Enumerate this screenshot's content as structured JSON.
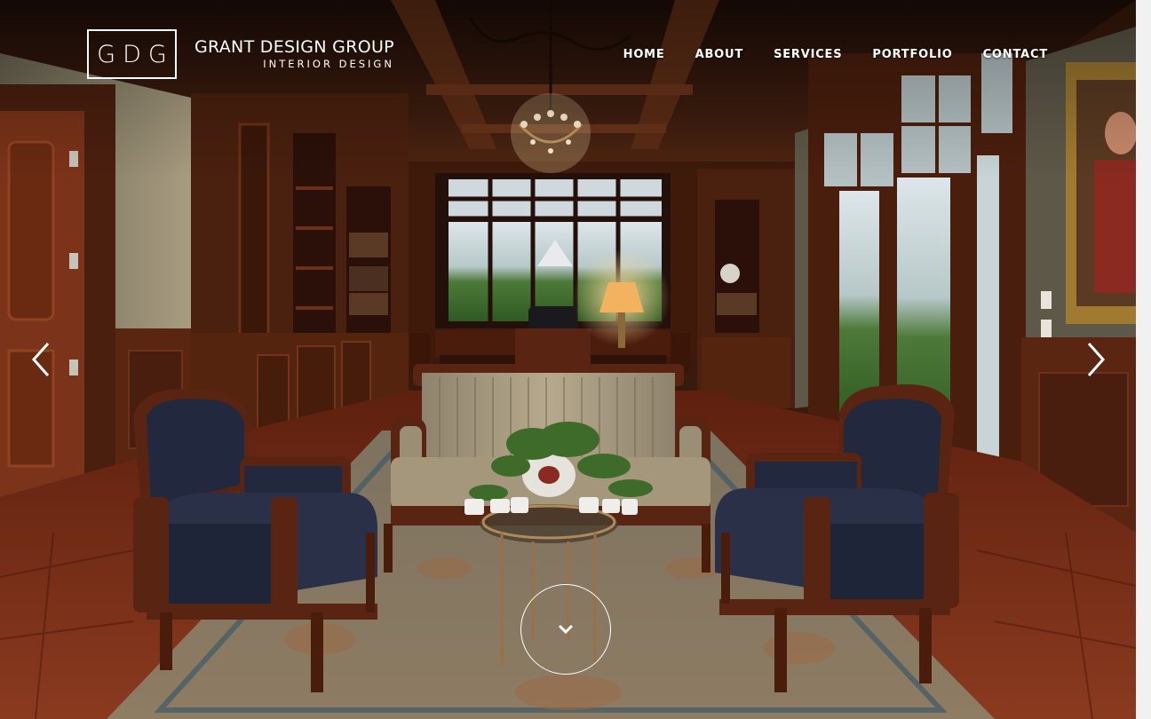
{
  "brand": {
    "monogram": "GDG",
    "name": "GRANT DESIGN GROUP",
    "tagline": "INTERIOR DESIGN"
  },
  "nav": {
    "items": [
      {
        "label": "HOME"
      },
      {
        "label": "ABOUT"
      },
      {
        "label": "SERVICES"
      },
      {
        "label": "PORTFOLIO"
      },
      {
        "label": "CONTACT"
      }
    ]
  },
  "slider": {
    "prev_icon": "chevron-left-icon",
    "next_icon": "chevron-right-icon",
    "scroll_icon": "chevron-down-icon"
  },
  "colors": {
    "text": "#ffffff",
    "wood": "#5a2a16",
    "floor": "#7a2e18",
    "upholstery": "#20263f"
  }
}
